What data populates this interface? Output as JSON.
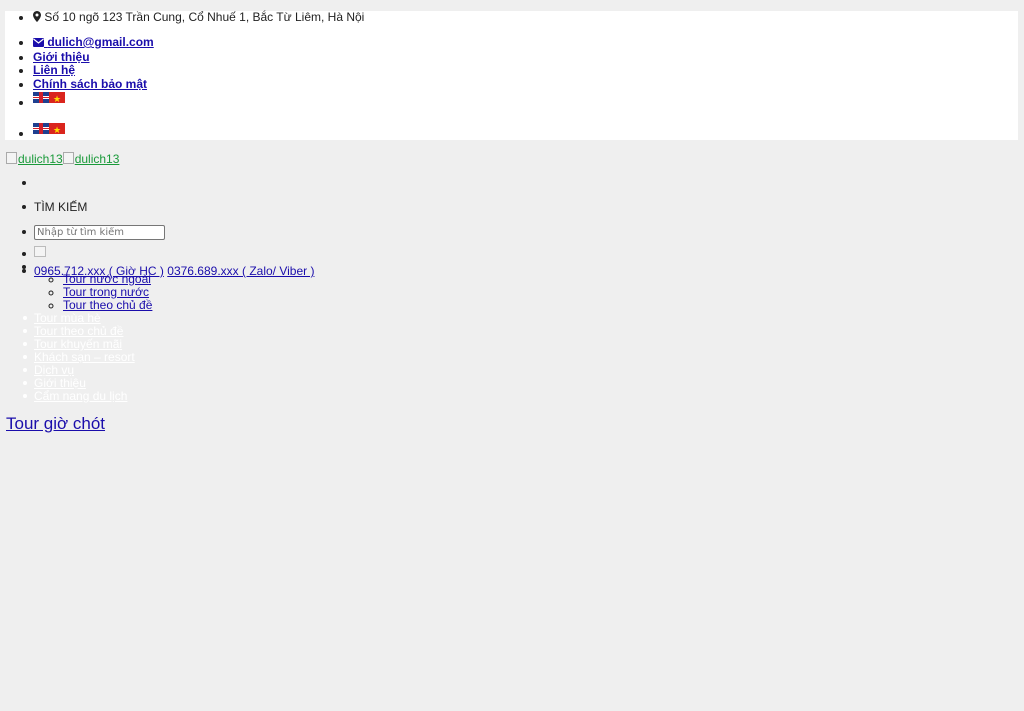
{
  "topbar": {
    "address": "Số 10 ngõ 123 Trần Cung, Cổ Nhuế 1, Bắc Từ Liêm, Hà Nội",
    "email": "dulich@gmail.com",
    "links": [
      "Giới thiệu",
      "Liên hệ",
      "Chính sách bảo mật"
    ]
  },
  "logo": {
    "alt1": "dulich13",
    "alt2": "dulich13"
  },
  "search": {
    "label": "TÌM KIẾM",
    "placeholder": "Nhập từ tìm kiếm"
  },
  "phones": {
    "office": "0965.712.xxx ( Giờ HC )",
    "zalo": "0376.689.xxx ( Zalo/ Viber )"
  },
  "submenu": [
    "Tour nước ngoài",
    "Tour trong nước",
    "Tour theo chủ đề"
  ],
  "mainmenu": [
    "Tour mùa hè",
    "Tour theo chủ đề",
    "Tour khuyến mãi",
    "Khách sạn – resort",
    "Dịch vụ",
    "Giới thiệu",
    "Cẩm nang du lịch"
  ],
  "section": {
    "title": "Tour giờ chót"
  },
  "icons": {
    "address": "map-marker-icon",
    "email": "envelope-icon"
  },
  "colors": {
    "link": "#1a0dab",
    "logo_link": "#1a9a3a",
    "background": "#efefef"
  }
}
